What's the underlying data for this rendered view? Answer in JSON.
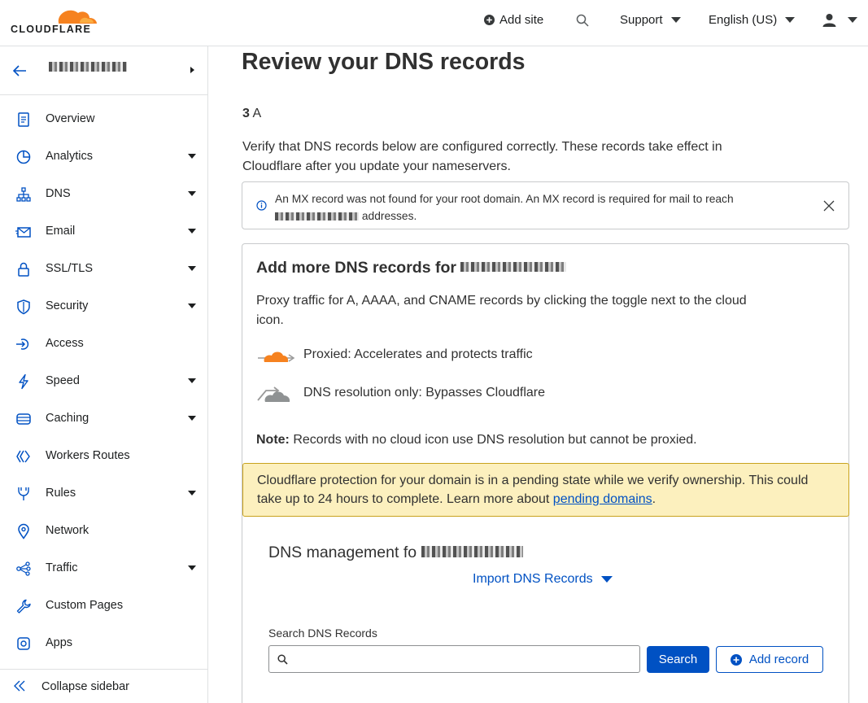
{
  "header": {
    "logo_text": "CLOUDFLARE",
    "add_site": "Add site",
    "support": "Support",
    "language": "English (US)"
  },
  "sidebar": {
    "back_icon": "arrow-left-icon",
    "items": [
      {
        "label": "Overview",
        "icon": "clipboard-icon"
      },
      {
        "label": "Analytics",
        "icon": "pie-chart-icon"
      },
      {
        "label": "DNS",
        "icon": "network-tree-icon"
      },
      {
        "label": "Email",
        "icon": "envelope-icon"
      },
      {
        "label": "SSL/TLS",
        "icon": "lock-icon"
      },
      {
        "label": "Security",
        "icon": "shield-icon"
      },
      {
        "label": "Access",
        "icon": "access-icon"
      },
      {
        "label": "Speed",
        "icon": "lightning-icon"
      },
      {
        "label": "Caching",
        "icon": "server-icon"
      },
      {
        "label": "Workers Routes",
        "icon": "workers-icon"
      },
      {
        "label": "Rules",
        "icon": "fork-icon"
      },
      {
        "label": "Network",
        "icon": "location-pin-icon"
      },
      {
        "label": "Traffic",
        "icon": "traffic-icon"
      },
      {
        "label": "Custom Pages",
        "icon": "wrench-icon"
      },
      {
        "label": "Apps",
        "icon": "apps-icon"
      }
    ],
    "collapse_label": "Collapse sidebar"
  },
  "main": {
    "title": "Review your DNS records",
    "step_number": "3",
    "step_letter": "A",
    "description": "Verify that DNS records below are configured correctly. These records take effect in Cloudflare after you update your nameservers.",
    "notice": {
      "line1": "An MX record was not found for your root domain. An MX record is required for mail to reach",
      "line2_suffix": "addresses."
    },
    "card": {
      "title_prefix": "Add more DNS records for",
      "intro": "Proxy traffic for A, AAAA, and CNAME records by clicking the toggle next to the cloud icon.",
      "proxied_label": "Proxied: Accelerates and protects traffic",
      "dns_only_label": "DNS resolution only: Bypasses Cloudflare",
      "note_bold": "Note:",
      "note_text": "Records with no cloud icon use DNS resolution but cannot be proxied."
    },
    "warning": {
      "text": "Cloudflare protection for your domain is in a pending state while we verify ownership. This could take up to 24 hours to complete. Learn more about",
      "link": "pending domains",
      "end": "."
    },
    "management": {
      "title_prefix": "DNS management fo",
      "import_label": "Import DNS Records",
      "search_label": "Search DNS Records",
      "search_value": "",
      "search_button": "Search",
      "add_button": "Add record"
    }
  },
  "colors": {
    "brand_orange": "#f6821f",
    "link_blue": "#0051c3",
    "warning_bg": "#fcf0be",
    "warning_border": "#c8a21e"
  }
}
